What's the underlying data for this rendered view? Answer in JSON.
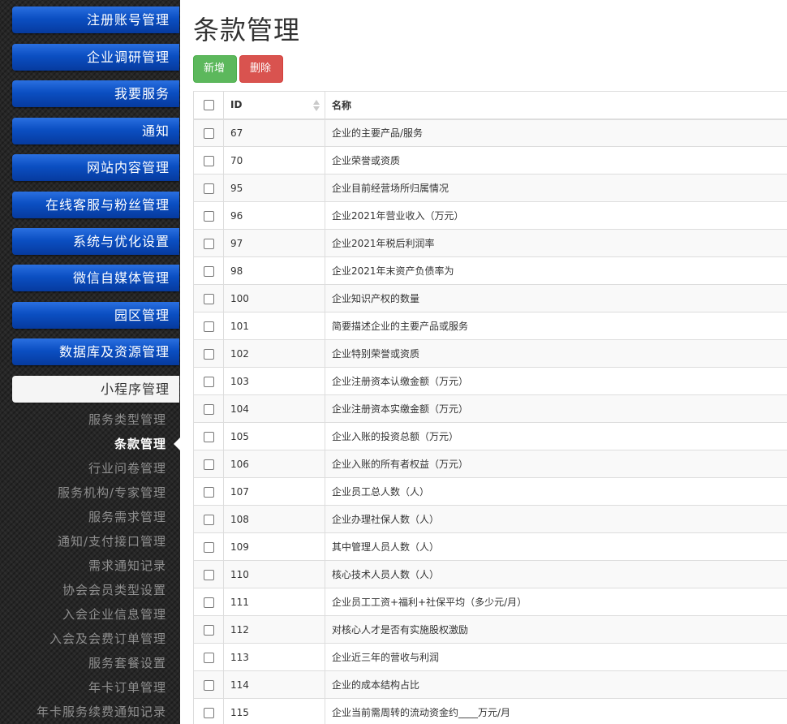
{
  "sidebar": {
    "menu": [
      {
        "label": "注册账号管理"
      },
      {
        "label": "企业调研管理"
      },
      {
        "label": "我要服务"
      },
      {
        "label": "通知"
      },
      {
        "label": "网站内容管理"
      },
      {
        "label": "在线客服与粉丝管理"
      },
      {
        "label": "系统与优化设置"
      },
      {
        "label": "微信自媒体管理"
      },
      {
        "label": "园区管理"
      },
      {
        "label": "数据库及资源管理"
      },
      {
        "label": "小程序管理"
      }
    ],
    "submenu": [
      {
        "label": "服务类型管理"
      },
      {
        "label": "条款管理"
      },
      {
        "label": "行业问卷管理"
      },
      {
        "label": "服务机构/专家管理"
      },
      {
        "label": "服务需求管理"
      },
      {
        "label": "通知/支付接口管理"
      },
      {
        "label": "需求通知记录"
      },
      {
        "label": "协会会员类型设置"
      },
      {
        "label": "入会企业信息管理"
      },
      {
        "label": "入会及会费订单管理"
      },
      {
        "label": "服务套餐设置"
      },
      {
        "label": "年卡订单管理"
      },
      {
        "label": "年卡服务续费通知记录"
      }
    ]
  },
  "main": {
    "title": "条款管理",
    "buttons": {
      "add": "新增",
      "delete": "删除"
    },
    "table": {
      "headers": {
        "id": "ID",
        "name": "名称"
      },
      "rows": [
        {
          "id": "67",
          "name": "企业的主要产品/服务"
        },
        {
          "id": "70",
          "name": "企业荣誉或资质"
        },
        {
          "id": "95",
          "name": "企业目前经营场所归属情况"
        },
        {
          "id": "96",
          "name": "企业2021年营业收入（万元）"
        },
        {
          "id": "97",
          "name": "企业2021年税后利润率"
        },
        {
          "id": "98",
          "name": "企业2021年末资产负债率为"
        },
        {
          "id": "100",
          "name": "企业知识产权的数量"
        },
        {
          "id": "101",
          "name": "简要描述企业的主要产品或服务"
        },
        {
          "id": "102",
          "name": "企业特别荣誉或资质"
        },
        {
          "id": "103",
          "name": "企业注册资本认缴金额（万元）"
        },
        {
          "id": "104",
          "name": "企业注册资本实缴金额（万元）"
        },
        {
          "id": "105",
          "name": "企业入账的投资总额（万元）"
        },
        {
          "id": "106",
          "name": "企业入账的所有者权益（万元）"
        },
        {
          "id": "107",
          "name": "企业员工总人数（人）"
        },
        {
          "id": "108",
          "name": "企业办理社保人数（人）"
        },
        {
          "id": "109",
          "name": "其中管理人员人数（人）"
        },
        {
          "id": "110",
          "name": "核心技术人员人数（人）"
        },
        {
          "id": "111",
          "name": "企业员工工资+福利+社保平均（多少元/月）"
        },
        {
          "id": "112",
          "name": "对核心人才是否有实施股权激励"
        },
        {
          "id": "113",
          "name": "企业近三年的营收与利润"
        },
        {
          "id": "114",
          "name": "企业的成本结构占比"
        },
        {
          "id": "115",
          "name": "企业当前需周转的流动资金约____万元/月"
        }
      ]
    }
  }
}
